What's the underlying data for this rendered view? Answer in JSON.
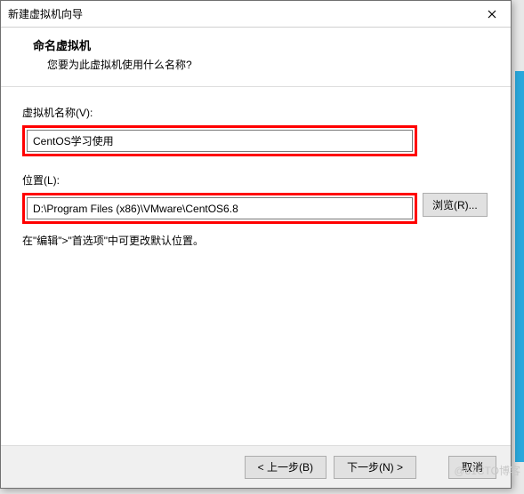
{
  "titlebar": {
    "title": "新建虚拟机向导"
  },
  "header": {
    "title": "命名虚拟机",
    "subtitle": "您要为此虚拟机使用什么名称?"
  },
  "fields": {
    "name_label": "虚拟机名称(V):",
    "name_value": "CentOS学习使用",
    "location_label": "位置(L):",
    "location_value": "D:\\Program Files (x86)\\VMware\\CentOS6.8",
    "browse_label": "浏览(R)...",
    "hint": "在\"编辑\">\"首选项\"中可更改默认位置。"
  },
  "footer": {
    "back": "< 上一步(B)",
    "next": "下一步(N) >",
    "cancel": "取消"
  },
  "watermark": "@51CTO博客"
}
